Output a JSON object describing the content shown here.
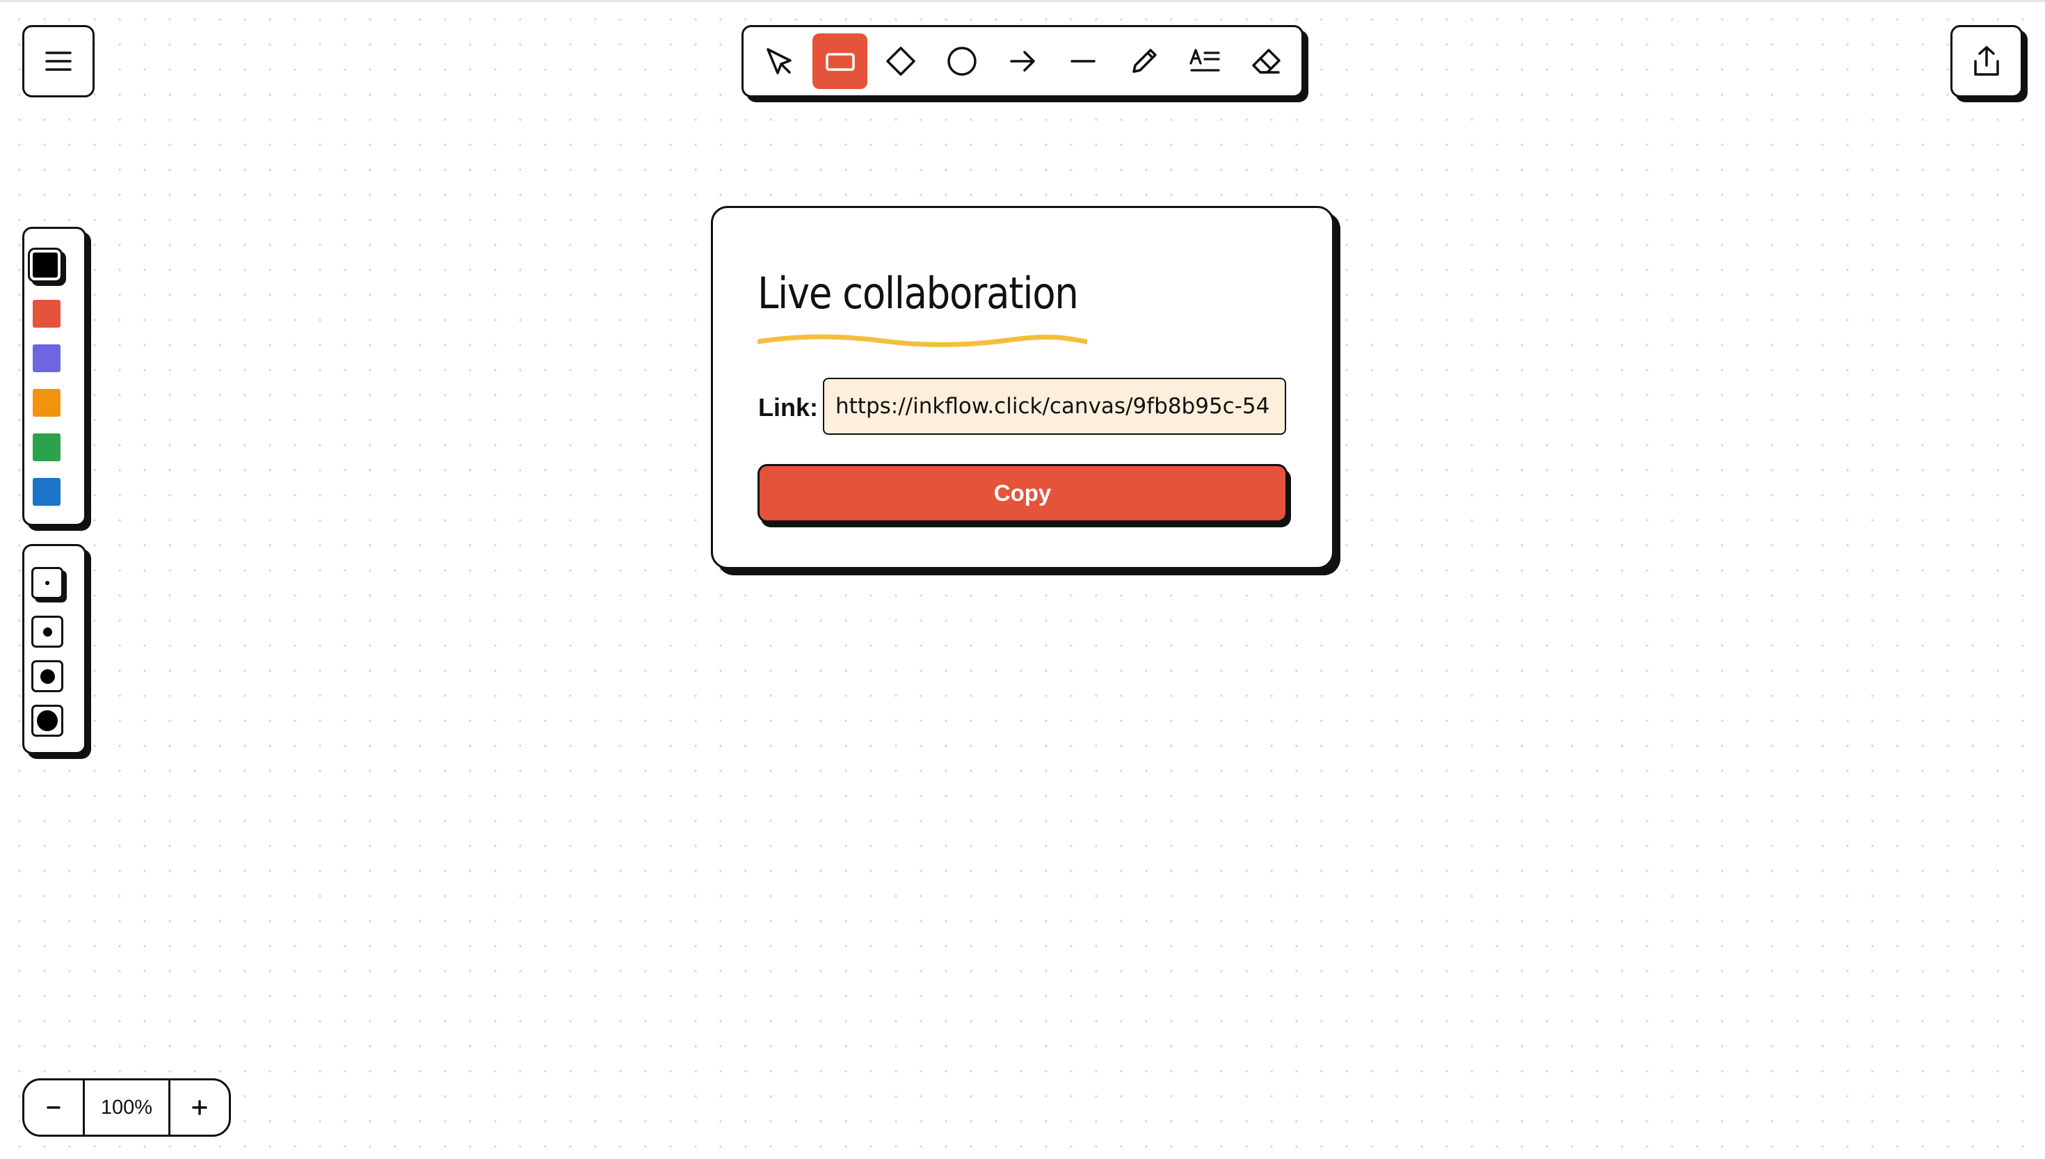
{
  "toolbar": {
    "tools": [
      {
        "name": "select",
        "icon": "pointer-icon",
        "active": false
      },
      {
        "name": "rectangle",
        "icon": "rectangle-icon",
        "active": true
      },
      {
        "name": "diamond",
        "icon": "diamond-icon",
        "active": false
      },
      {
        "name": "ellipse",
        "icon": "circle-icon",
        "active": false
      },
      {
        "name": "arrow",
        "icon": "arrow-right-icon",
        "active": false
      },
      {
        "name": "line",
        "icon": "line-icon",
        "active": false
      },
      {
        "name": "pencil",
        "icon": "pencil-icon",
        "active": false
      },
      {
        "name": "text",
        "icon": "text-icon",
        "active": false
      },
      {
        "name": "eraser",
        "icon": "eraser-icon",
        "active": false
      }
    ],
    "active_color": "#e5533a"
  },
  "menu": {
    "icon": "hamburger-menu-icon"
  },
  "share": {
    "icon": "share-upload-icon"
  },
  "palette": {
    "colors": [
      "#000000",
      "#e5533a",
      "#7065e0",
      "#f2930f",
      "#2ca24a",
      "#1c74c8"
    ],
    "selected": "#000000"
  },
  "stroke_sizes": {
    "options": [
      "extra-thin",
      "thin",
      "medium",
      "thick"
    ],
    "selected": "extra-thin"
  },
  "dialog": {
    "title": "Live collaboration",
    "underline_color": "#f4be3c",
    "link_label": "Link:",
    "link_value": "https://inkflow.click/canvas/9fb8b95c-54",
    "copy_label": "Copy",
    "input_bg": "#fdefdb"
  },
  "zoom": {
    "minus": "−",
    "level": "100%",
    "plus": "+"
  }
}
